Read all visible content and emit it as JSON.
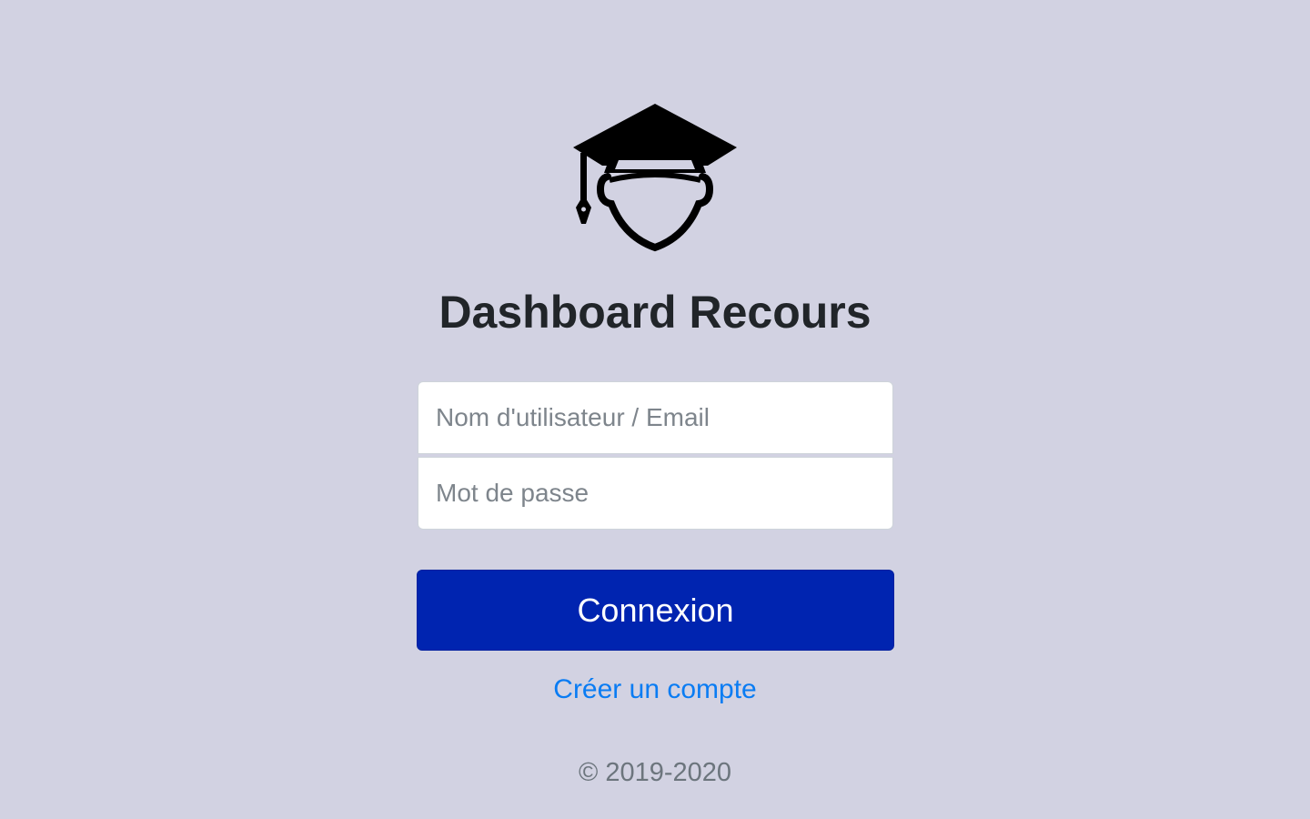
{
  "app": {
    "title": "Dashboard Recours",
    "logo_icon": "graduation-cap-head-icon"
  },
  "login_form": {
    "username_placeholder": "Nom d'utilisateur / Email",
    "username_value": "",
    "password_placeholder": "Mot de passe",
    "password_value": "",
    "submit_label": "Connexion",
    "create_account_label": "Créer un compte"
  },
  "footer": {
    "copyright": "© 2019-2020"
  },
  "colors": {
    "background": "#d2d2e2",
    "primary_button": "#0024b0",
    "link": "#0a7cf3",
    "title": "#212529",
    "muted_text": "#6c757d"
  }
}
